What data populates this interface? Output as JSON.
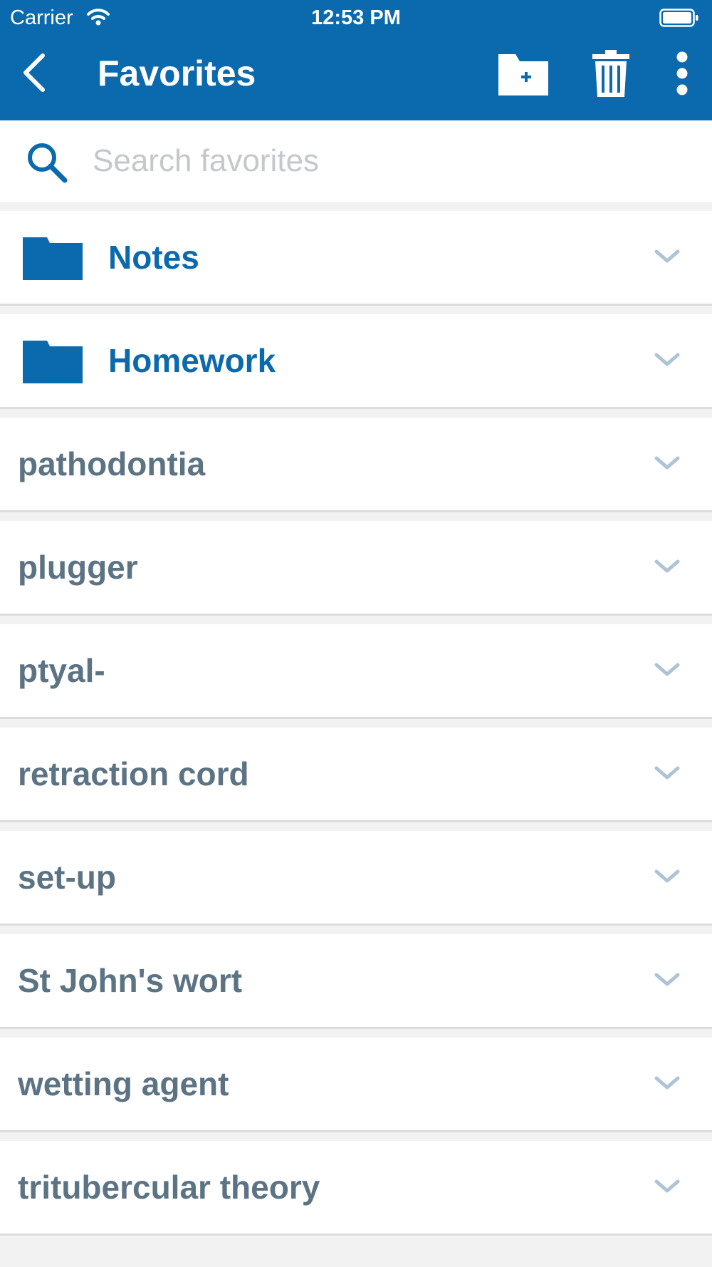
{
  "status_bar": {
    "carrier": "Carrier",
    "time": "12:53 PM"
  },
  "nav": {
    "title": "Favorites",
    "icons": {
      "back": "chevron-left-icon",
      "new_folder": "folder-plus-icon",
      "delete": "trash-icon",
      "more": "vertical-ellipsis-icon"
    }
  },
  "search": {
    "value": "",
    "placeholder": "Search favorites"
  },
  "colors": {
    "brand": "#0b69ad",
    "word_text": "#5c7384",
    "chevron": "#aec4d6",
    "background": "#f2f2f2"
  },
  "favorites": {
    "folders": [
      {
        "label": "Notes"
      },
      {
        "label": "Homework"
      }
    ],
    "words": [
      {
        "label": "pathodontia"
      },
      {
        "label": "plugger"
      },
      {
        "label": "ptyal-"
      },
      {
        "label": "retraction cord"
      },
      {
        "label": "set-up"
      },
      {
        "label": "St John's wort"
      },
      {
        "label": "wetting agent"
      },
      {
        "label": "tritubercular theory"
      }
    ]
  }
}
